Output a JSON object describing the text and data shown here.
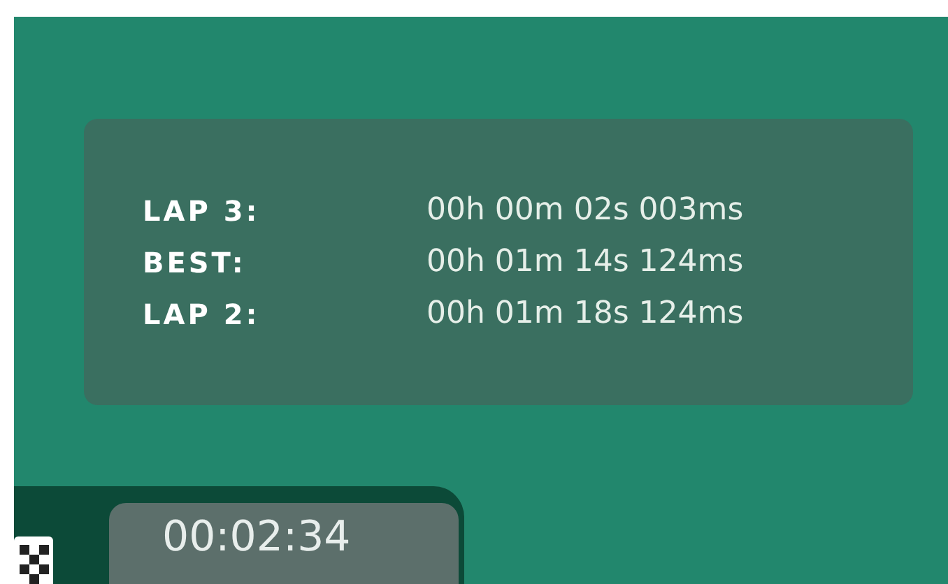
{
  "laps": [
    {
      "label": "LAP 3:",
      "time": "00h 00m 02s 003ms"
    },
    {
      "label": "BEST:",
      "time": "00h 01m 14s 124ms"
    },
    {
      "label": "LAP 2:",
      "time": "00h 01m 18s 124ms"
    }
  ],
  "timer": "00:02:34"
}
